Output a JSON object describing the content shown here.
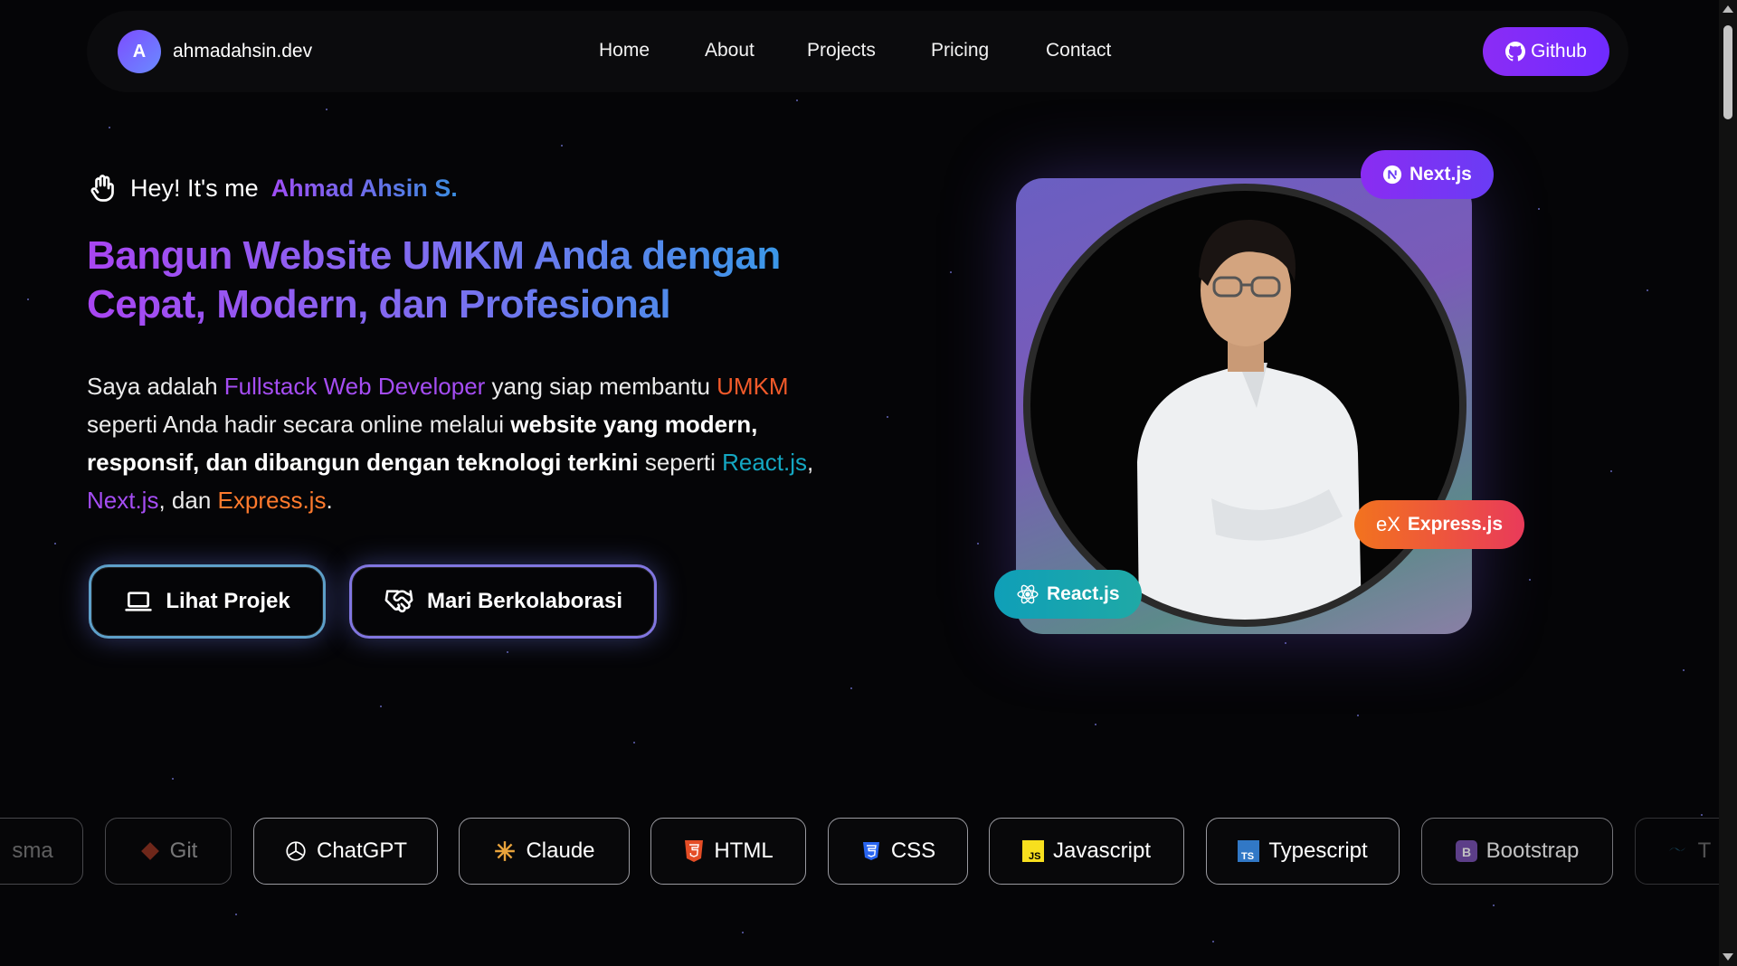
{
  "nav": {
    "avatar_letter": "A",
    "brand": "ahmadahsin.dev",
    "links": [
      "Home",
      "About",
      "Projects",
      "Pricing",
      "Contact"
    ],
    "github_label": "Github"
  },
  "hero": {
    "greeting_prefix": "Hey! It's me",
    "greeting_name": "Ahmad Ahsin S.",
    "headline": "Bangun Website UMKM Anda dengan Cepat, Modern, dan Profesional",
    "desc": {
      "p1": "Saya adalah ",
      "role": "Fullstack Web Developer",
      "p2": " yang siap membantu ",
      "umkm": "UMKM",
      "p3": " seperti Anda hadir secara online melalui ",
      "bold": "website yang modern, responsif, dan dibangun dengan teknologi terkini",
      "p4": " seperti ",
      "react": "React.js",
      "comma": ",",
      "next": "Next.js",
      "p5": ", dan ",
      "express": "Express.js",
      "end": "."
    },
    "buttons": {
      "projects": "Lihat Projek",
      "collab": "Mari Berkolaborasi"
    },
    "chips": {
      "next": "Next.js",
      "express": "Express.js",
      "express_prefix": "eX",
      "react": "React.js"
    }
  },
  "tech": [
    "sma",
    "Git",
    "ChatGPT",
    "Claude",
    "HTML",
    "CSS",
    "Javascript",
    "Typescript",
    "Bootstrap",
    "T"
  ],
  "colors": {
    "accent_purple": "#8b2cf5",
    "accent_blue": "#2aa2e6",
    "express_orange": "#f2731e",
    "react_teal": "#0f9fb8"
  }
}
